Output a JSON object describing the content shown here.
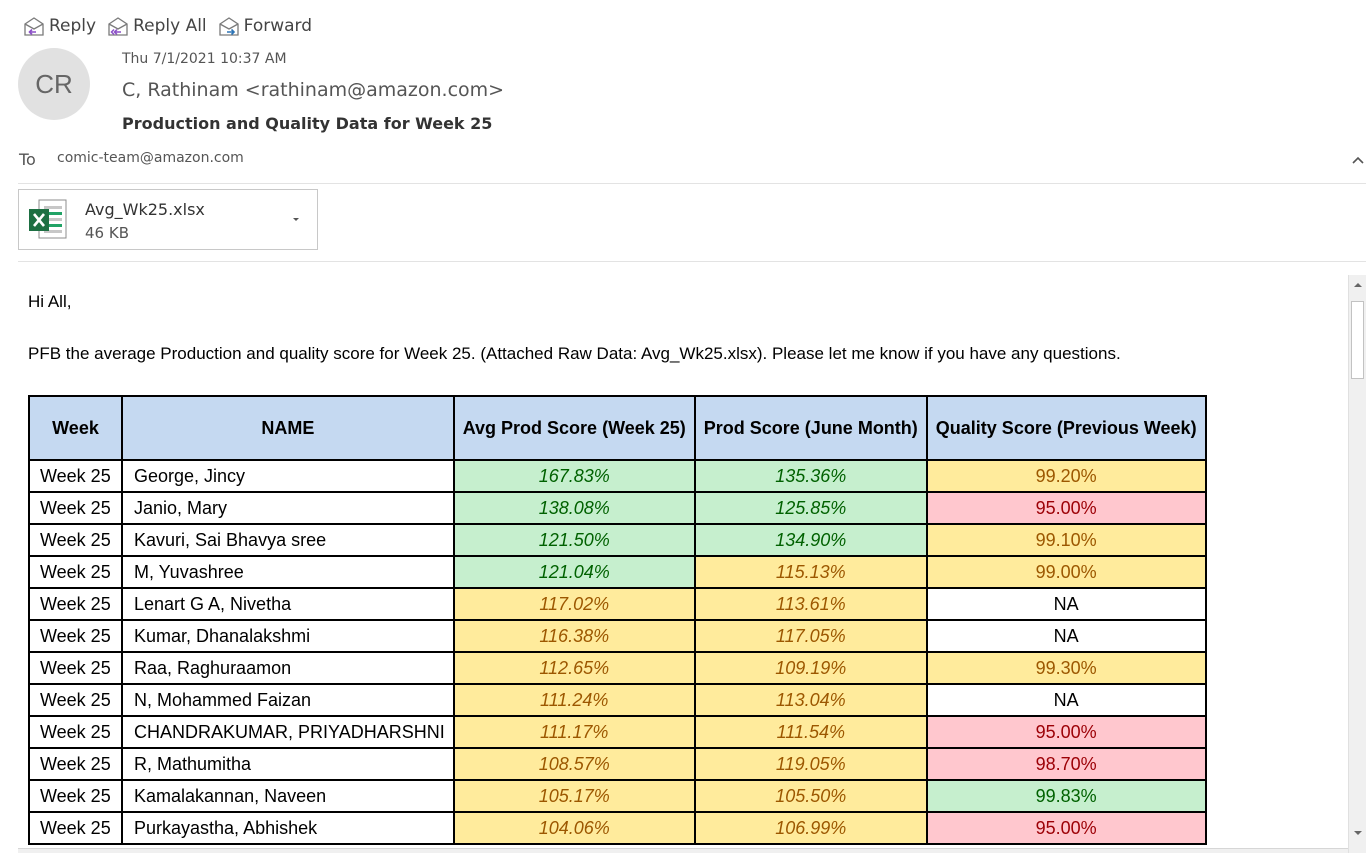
{
  "toolbar": {
    "reply": "Reply",
    "reply_all": "Reply All",
    "forward": "Forward"
  },
  "header": {
    "avatar_initials": "CR",
    "date": "Thu 7/1/2021 10:37 AM",
    "from": "C, Rathinam <rathinam@amazon.com>",
    "subject": "Production and Quality Data for Week 25",
    "to_label": "To",
    "to_value": "comic-team@amazon.com"
  },
  "attachment": {
    "icon": "excel-file-icon",
    "name": "Avg_Wk25.xlsx",
    "size": "46 KB"
  },
  "body": {
    "greeting": "Hi All,",
    "message": "PFB the average Production and quality score for Week 25. (Attached Raw Data: Avg_Wk25.xlsx). Please let me know if you have any questions."
  },
  "table": {
    "headers": [
      "Week",
      "NAME",
      "Avg Prod Score (Week 25)",
      "Prod Score (June Month)",
      "Quality Score (Previous Week)"
    ],
    "rows": [
      {
        "week": "Week 25",
        "name": "George, Jincy",
        "avg": "167.83%",
        "avg_color": "green",
        "june": "135.36%",
        "june_color": "green",
        "quality": "99.20%",
        "quality_color": "yellow"
      },
      {
        "week": "Week 25",
        "name": "Janio, Mary",
        "avg": "138.08%",
        "avg_color": "green",
        "june": "125.85%",
        "june_color": "green",
        "quality": "95.00%",
        "quality_color": "red"
      },
      {
        "week": "Week 25",
        "name": "Kavuri, Sai Bhavya sree",
        "avg": "121.50%",
        "avg_color": "green",
        "june": "134.90%",
        "june_color": "green",
        "quality": "99.10%",
        "quality_color": "yellow"
      },
      {
        "week": "Week 25",
        "name": "M, Yuvashree",
        "avg": "121.04%",
        "avg_color": "green",
        "june": "115.13%",
        "june_color": "yellow",
        "quality": "99.00%",
        "quality_color": "yellow"
      },
      {
        "week": "Week 25",
        "name": "Lenart G A, Nivetha",
        "avg": "117.02%",
        "avg_color": "yellow",
        "june": "113.61%",
        "june_color": "yellow",
        "quality": "NA",
        "quality_color": "white"
      },
      {
        "week": "Week 25",
        "name": "Kumar, Dhanalakshmi",
        "avg": "116.38%",
        "avg_color": "yellow",
        "june": "117.05%",
        "june_color": "yellow",
        "quality": "NA",
        "quality_color": "white"
      },
      {
        "week": "Week 25",
        "name": "Raa, Raghuraamon",
        "avg": "112.65%",
        "avg_color": "yellow",
        "june": "109.19%",
        "june_color": "yellow",
        "quality": "99.30%",
        "quality_color": "yellow"
      },
      {
        "week": "Week 25",
        "name": "N, Mohammed Faizan",
        "avg": "111.24%",
        "avg_color": "yellow",
        "june": "113.04%",
        "june_color": "yellow",
        "quality": "NA",
        "quality_color": "white"
      },
      {
        "week": "Week 25",
        "name": "CHANDRAKUMAR, PRIYADHARSHNI",
        "avg": "111.17%",
        "avg_color": "yellow",
        "june": "111.54%",
        "june_color": "yellow",
        "quality": "95.00%",
        "quality_color": "red"
      },
      {
        "week": "Week 25",
        "name": "R, Mathumitha",
        "avg": "108.57%",
        "avg_color": "yellow",
        "june": "119.05%",
        "june_color": "yellow",
        "quality": "98.70%",
        "quality_color": "red"
      },
      {
        "week": "Week 25",
        "name": "Kamalakannan, Naveen",
        "avg": "105.17%",
        "avg_color": "yellow",
        "june": "105.50%",
        "june_color": "yellow",
        "quality": "99.83%",
        "quality_color": "green"
      },
      {
        "week": "Week 25",
        "name": "Purkayastha, Abhishek",
        "avg": "104.06%",
        "avg_color": "yellow",
        "june": "106.99%",
        "june_color": "yellow",
        "quality": "95.00%",
        "quality_color": "red"
      }
    ]
  },
  "colors": {
    "header_fill": "#c5d9f1",
    "green_fill": "#c6efce",
    "green_text": "#006100",
    "yellow_fill": "#ffeb9c",
    "yellow_text": "#9c5700",
    "red_fill": "#ffc7ce",
    "red_text": "#9c0006"
  }
}
